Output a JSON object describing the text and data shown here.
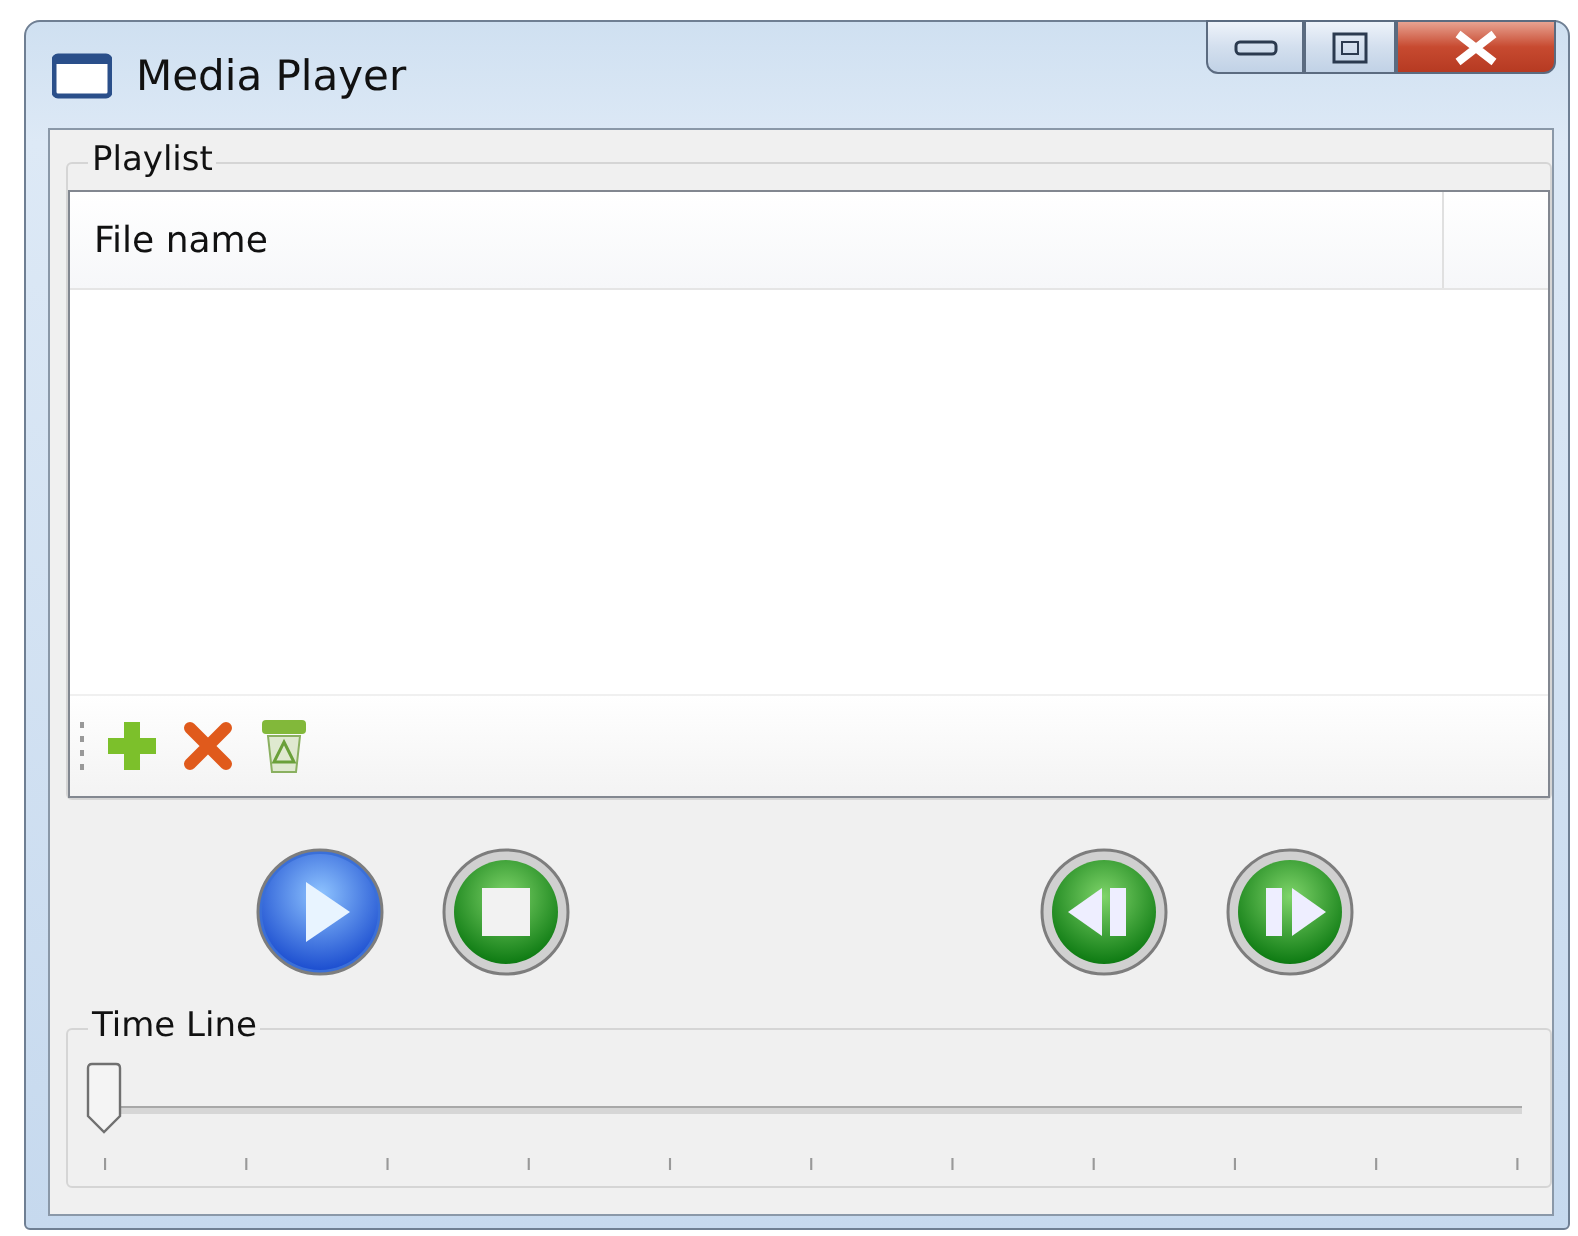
{
  "window": {
    "title": "Media Player"
  },
  "playlist": {
    "title": "Playlist",
    "columns": [
      "File name"
    ]
  },
  "transport": [
    {
      "kind": "play"
    },
    {
      "kind": "stop"
    },
    {
      "kind": "previous"
    },
    {
      "kind": "next"
    }
  ],
  "timeline": {
    "title": "Time Line",
    "level": 0
  }
}
